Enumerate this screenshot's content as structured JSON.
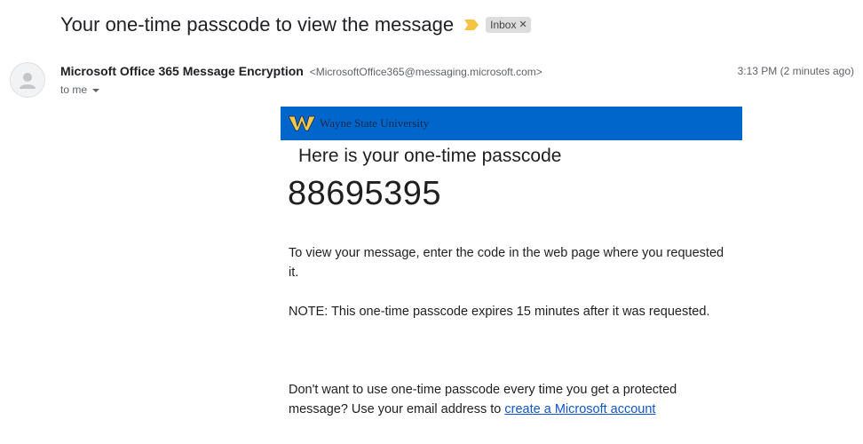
{
  "email": {
    "subject": "Your one-time passcode to view the message",
    "labels": [
      {
        "name": "Inbox"
      }
    ],
    "sender": {
      "name": "Microsoft Office 365 Message Encryption",
      "email": "<MicrosoftOffice365@messaging.microsoft.com>"
    },
    "recipient_text": "to me",
    "timestamp": "3:13 PM (2 minutes ago)"
  },
  "body": {
    "banner_text": "Wayne State University",
    "heading": "Here is your one-time passcode",
    "passcode": "88695395",
    "instruction": "To view your message, enter the code in the web page where you requested it.",
    "note": "NOTE: This one-time passcode expires 15 minutes after it was requested.",
    "footer_prefix": "Don't want to use one-time passcode every time you get a protected message? Use your email address to ",
    "footer_link": "create a Microsoft account"
  },
  "colors": {
    "banner": "#0066cc",
    "link": "#1155cc",
    "importance_marker": "#f6c344"
  },
  "icons": {
    "importance": "importance-marker-icon",
    "label_remove": "close-icon",
    "avatar": "default-avatar-icon",
    "recipient_details": "chevron-down-icon",
    "logo": "wayne-state-w-logo"
  }
}
